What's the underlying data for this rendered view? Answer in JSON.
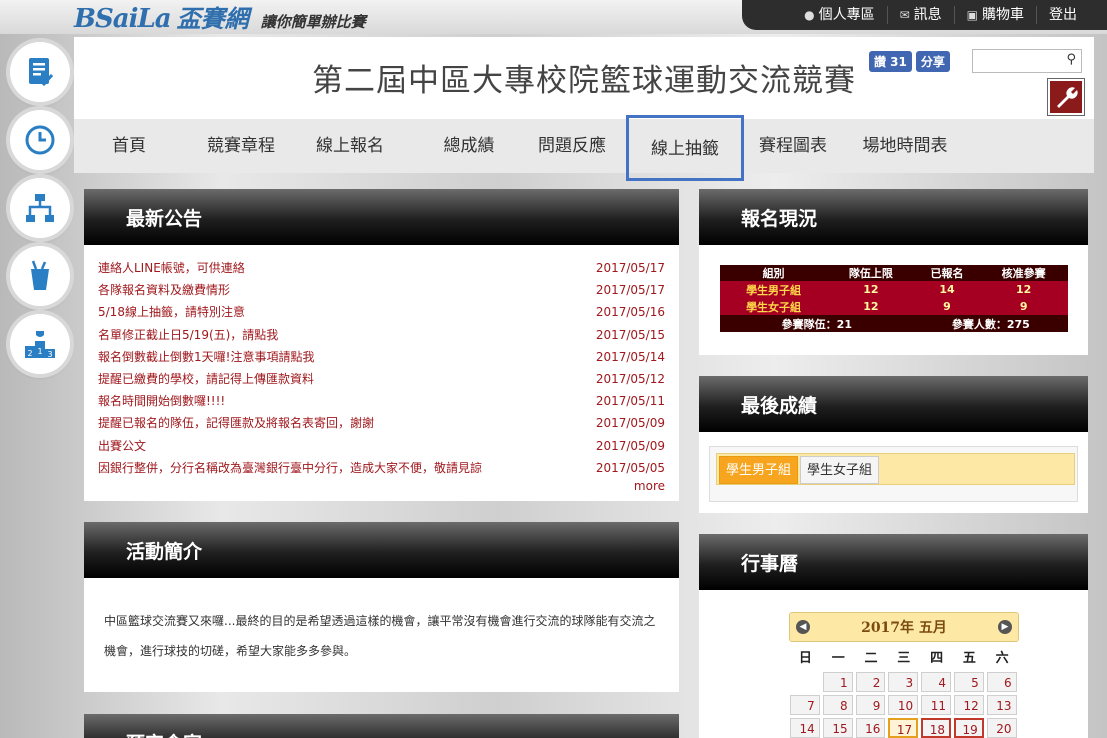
{
  "topbar": {
    "brand": "BSaiLa",
    "brand_cn": "盃賽網",
    "slogan": "讓你簡單辦比賽",
    "user_links": [
      {
        "label": "個人專區",
        "icon": "person-icon"
      },
      {
        "label": "訊息",
        "icon": "envelope-icon"
      },
      {
        "label": "購物車",
        "icon": "basket-icon"
      },
      {
        "label": "登出",
        "icon": ""
      }
    ]
  },
  "sidenav": [
    {
      "name": "registration-list-icon"
    },
    {
      "name": "clock-icon"
    },
    {
      "name": "bracket-icon"
    },
    {
      "name": "drinks-icon"
    },
    {
      "name": "podium-icon"
    }
  ],
  "header": {
    "title": "第二屆中區大專校院籃球運動交流競賽",
    "fb_like": "讚 31",
    "fb_share": "分享",
    "search_placeholder": ""
  },
  "menu": [
    "首頁",
    "競賽章程",
    "線上報名",
    "總成績",
    "問題反應",
    "線上抽籤",
    "賽程圖表",
    "場地時間表"
  ],
  "news": {
    "title": "最新公告",
    "items": [
      {
        "text": "連絡人LINE帳號，可供連絡",
        "date": "2017/05/17"
      },
      {
        "text": "各隊報名資料及繳費情形",
        "date": "2017/05/17"
      },
      {
        "text": "5/18線上抽籤，請特別注意",
        "date": "2017/05/16"
      },
      {
        "text": "名單修正截止日5/19(五)，請點我",
        "date": "2017/05/15"
      },
      {
        "text": "報名倒數截止倒數1天囉!注意事項請點我",
        "date": "2017/05/14"
      },
      {
        "text": "提醒已繳費的學校，請記得上傳匯款資料",
        "date": "2017/05/12"
      },
      {
        "text": "報名時間開始倒數囉!!!!",
        "date": "2017/05/11"
      },
      {
        "text": "提醒已報名的隊伍，記得匯款及將報名表寄回，謝謝",
        "date": "2017/05/09"
      },
      {
        "text": "出賽公文",
        "date": "2017/05/09"
      },
      {
        "text": "因銀行整併，分行名稱改為臺灣銀行臺中分行，造成大家不便，敬請見諒",
        "date": "2017/05/05"
      }
    ],
    "more": "more"
  },
  "intro": {
    "title": "活動簡介",
    "text": "中區籃球交流賽又來囉...最終的目的是希望透過這樣的機會，讓平常沒有機會進行交流的球隊能有交流之機會，進行球技的切磋，希望大家能多多參與。"
  },
  "next_panel_title": "預定食宿",
  "registration": {
    "title": "報名現況",
    "headers": [
      "組別",
      "隊伍上限",
      "已報名",
      "核准參賽"
    ],
    "rows": [
      [
        "學生男子組",
        "12",
        "14",
        "12"
      ],
      [
        "學生女子組",
        "12",
        "9",
        "9"
      ]
    ],
    "total_teams": "參賽隊伍：21",
    "total_people": "參賽人數：275"
  },
  "results": {
    "title": "最後成績",
    "tabs": [
      "學生男子組",
      "學生女子組"
    ]
  },
  "calendar": {
    "title": "行事曆",
    "year_month": "2017年 五月",
    "dow": [
      "日",
      "一",
      "二",
      "三",
      "四",
      "五",
      "六"
    ],
    "weeks": [
      [
        "",
        "1",
        "2",
        "3",
        "4",
        "5",
        "6"
      ],
      [
        "7",
        "8",
        "9",
        "10",
        "11",
        "12",
        "13"
      ],
      [
        "14",
        "15",
        "16",
        "17",
        "18",
        "19",
        "20"
      ]
    ]
  }
}
